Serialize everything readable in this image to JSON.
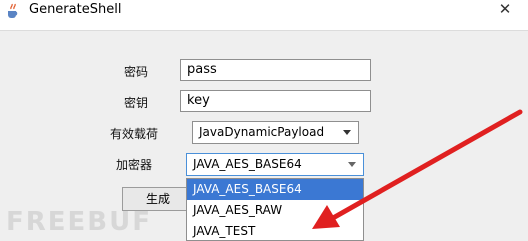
{
  "window": {
    "title": "GenerateShell",
    "close_glyph": "✕"
  },
  "form": {
    "password_label": "密码",
    "password_value": "pass",
    "key_label": "密钥",
    "key_value": "key",
    "payload_label": "有效载荷",
    "payload_value": "JavaDynamicPayload",
    "encryptor_label": "加密器",
    "encryptor_value": "JAVA_AES_BASE64",
    "generate_label": "生成"
  },
  "dropdown": {
    "options": [
      "JAVA_AES_BASE64",
      "JAVA_AES_RAW",
      "JAVA_TEST"
    ],
    "selected_index": 0
  },
  "watermark": {
    "text": "FREEBUF"
  },
  "colors": {
    "selection": "#3b78d3",
    "annotation_arrow": "#e02020"
  },
  "icons": {
    "app": "java-cup-icon",
    "close": "close-icon",
    "combo": "chevron-down-icon"
  }
}
